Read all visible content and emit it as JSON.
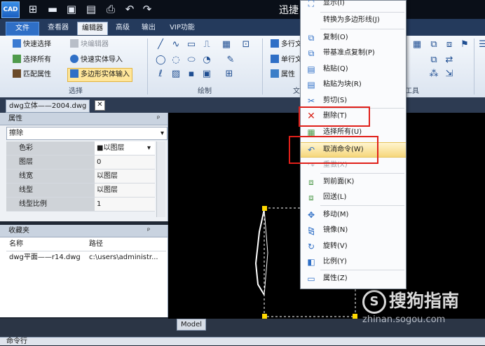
{
  "titlebar": {
    "app_icon": "CAD",
    "title": "迅捷",
    "quick_access": [
      "new-icon",
      "open-icon",
      "save-icon",
      "save-as-icon",
      "print-icon",
      "undo-icon",
      "redo-icon"
    ]
  },
  "ribbon_tabs": [
    "文件",
    "查看器",
    "编辑器",
    "高级",
    "输出",
    "VIP功能"
  ],
  "ribbon": {
    "select_group": {
      "label": "选择",
      "buttons": [
        "快速选择",
        "块编辑器",
        "选择所有",
        "快速实体导入",
        "匹配属性",
        "多边形实体输入"
      ]
    },
    "draw_group": {
      "label": "绘制"
    },
    "text_group": {
      "label": "文",
      "buttons": [
        "多行文",
        "单行文",
        "属性"
      ]
    },
    "tools_group": {
      "label": "工具"
    }
  },
  "document_tab": {
    "name": "dwg立体——2004.dwg",
    "close": "✕"
  },
  "properties": {
    "title": "属性",
    "pin": "ᵖ",
    "selector": "擦除",
    "rows": [
      {
        "name": "色彩",
        "value": "■以图层"
      },
      {
        "name": "图层",
        "value": "0"
      },
      {
        "name": "线宽",
        "value": "以图层"
      },
      {
        "name": "线型",
        "value": "以图层"
      },
      {
        "name": "线型比例",
        "value": "1"
      }
    ]
  },
  "favorites": {
    "title": "收藏夹",
    "pin": "ᵖ",
    "columns": [
      "名称",
      "路径"
    ],
    "rows": [
      {
        "name": "dwg平面——r14.dwg",
        "path": "c:\\users\\administr..."
      }
    ]
  },
  "context_menu": {
    "items": [
      {
        "label": "显示(I)",
        "icon": "display-icon",
        "enabled": true
      },
      {
        "label": "转换为多边形线(J)",
        "icon": "",
        "enabled": true
      },
      {
        "label": "复制(O)",
        "icon": "copy-icon",
        "enabled": true
      },
      {
        "label": "带基准点复制(P)",
        "icon": "copy-base-icon",
        "enabled": true
      },
      {
        "label": "粘贴(Q)",
        "icon": "paste-icon",
        "enabled": true
      },
      {
        "label": "粘贴为块(R)",
        "icon": "paste-block-icon",
        "enabled": true
      },
      {
        "label": "剪切(S)",
        "icon": "cut-icon",
        "enabled": true
      },
      {
        "label": "删除(T)",
        "icon": "delete-icon",
        "enabled": true
      },
      {
        "label": "选择所有(U)",
        "icon": "select-all-icon",
        "enabled": true
      },
      {
        "label": "取消命令(W)",
        "icon": "undo-icon",
        "enabled": true,
        "hover": true
      },
      {
        "label": "重做(X)",
        "icon": "redo-icon",
        "enabled": false
      },
      {
        "label": "到前面(K)",
        "icon": "bring-front-icon",
        "enabled": true
      },
      {
        "label": "回送(L)",
        "icon": "send-back-icon",
        "enabled": true
      },
      {
        "label": "移动(M)",
        "icon": "move-icon",
        "enabled": true
      },
      {
        "label": "镜像(N)",
        "icon": "mirror-icon",
        "enabled": true
      },
      {
        "label": "旋转(V)",
        "icon": "rotate-icon",
        "enabled": true
      },
      {
        "label": "比例(Y)",
        "icon": "scale-icon",
        "enabled": true
      },
      {
        "label": "属性(Z)",
        "icon": "properties-icon",
        "enabled": true
      }
    ]
  },
  "model_tab": "Model",
  "command_line": "命令行",
  "watermark": {
    "brand": "搜狗指南",
    "url": "zhinan.sogou.com"
  },
  "colors": {
    "hover": "#f6d77c",
    "annotation": "#e0201a",
    "delete": "#d9261c"
  }
}
